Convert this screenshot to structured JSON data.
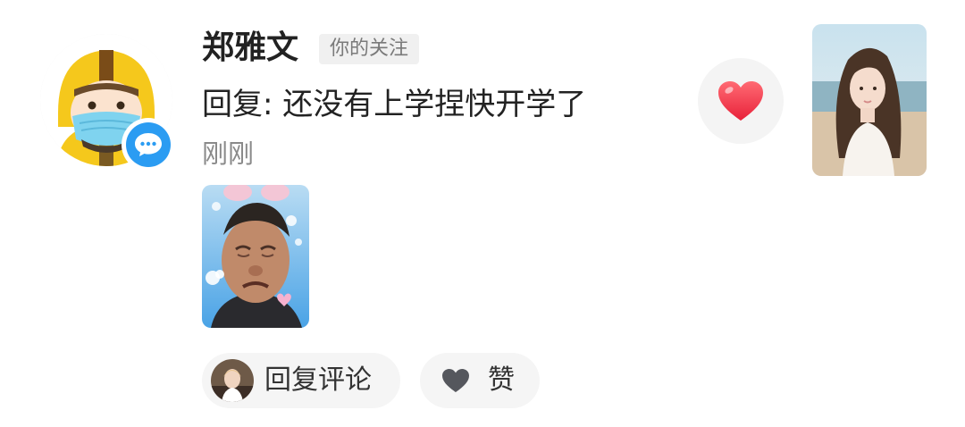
{
  "comment": {
    "username": "郑雅文",
    "follow_tag": "你的关注",
    "reply_text": "回复: 还没有上学捏快开学了",
    "timestamp": "刚刚"
  },
  "actions": {
    "reply_label": "回复评论",
    "like_label": "赞"
  },
  "icons": {
    "avatar": "delivery-rider-avatar",
    "badge": "message-bubble-icon",
    "heart": "heart-icon",
    "like": "heart-icon"
  },
  "colors": {
    "heart_red": "#f23a4c",
    "badge_blue": "#2b9cf2",
    "helmet_yellow": "#f5c81c",
    "like_icon_gray": "#55575d"
  }
}
